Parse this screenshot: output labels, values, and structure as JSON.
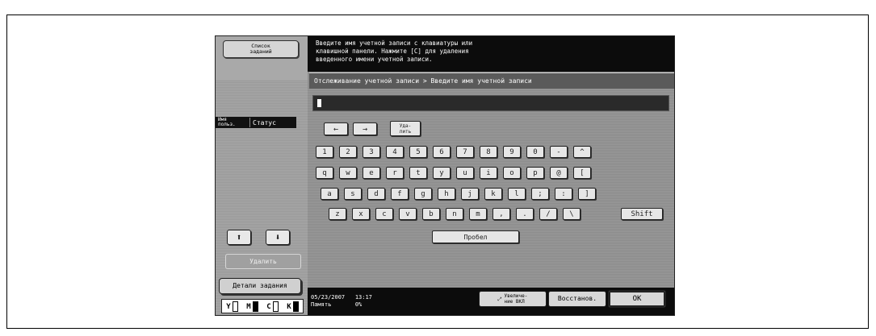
{
  "left_panel": {
    "jobs_button": "Список\nзаданий",
    "header_user": "Имя\nпольз.",
    "header_status": "Статус",
    "up_arrow": "⬆",
    "down_arrow": "⬇",
    "delete_button": "Удалить",
    "details_button": "Детали задания",
    "toner": [
      "Y",
      "M",
      "C",
      "K"
    ]
  },
  "message": [
    "Введите имя учетной записи с клавиатуры или",
    "клавишной панели. Нажмите [C] для удаления",
    "введенного имени учетной записи."
  ],
  "breadcrumb": "Отслеживание учетной записи > Введите имя учетной записи",
  "input": {
    "value": ""
  },
  "keyboard": {
    "left": "←",
    "right": "→",
    "delete": "Уда-\nлить",
    "row1": [
      "1",
      "2",
      "3",
      "4",
      "5",
      "6",
      "7",
      "8",
      "9",
      "0",
      "-",
      "^"
    ],
    "row2": [
      "q",
      "w",
      "e",
      "r",
      "t",
      "y",
      "u",
      "i",
      "o",
      "p",
      "@",
      "["
    ],
    "row3": [
      "a",
      "s",
      "d",
      "f",
      "g",
      "h",
      "j",
      "k",
      "l",
      ";",
      ":",
      "]"
    ],
    "row4": [
      "z",
      "x",
      "c",
      "v",
      "b",
      "n",
      "m",
      ",",
      ".",
      "/",
      "\\"
    ],
    "shift": "Shift",
    "space": "Пробел"
  },
  "footer": {
    "date": "05/23/2007",
    "time": "13:17",
    "memory_label": "Память",
    "memory_value": "0%",
    "zoom_button": "Увеличе-\nние ВКЛ",
    "reset_button": "Восстанов.",
    "ok_button": "OK"
  }
}
